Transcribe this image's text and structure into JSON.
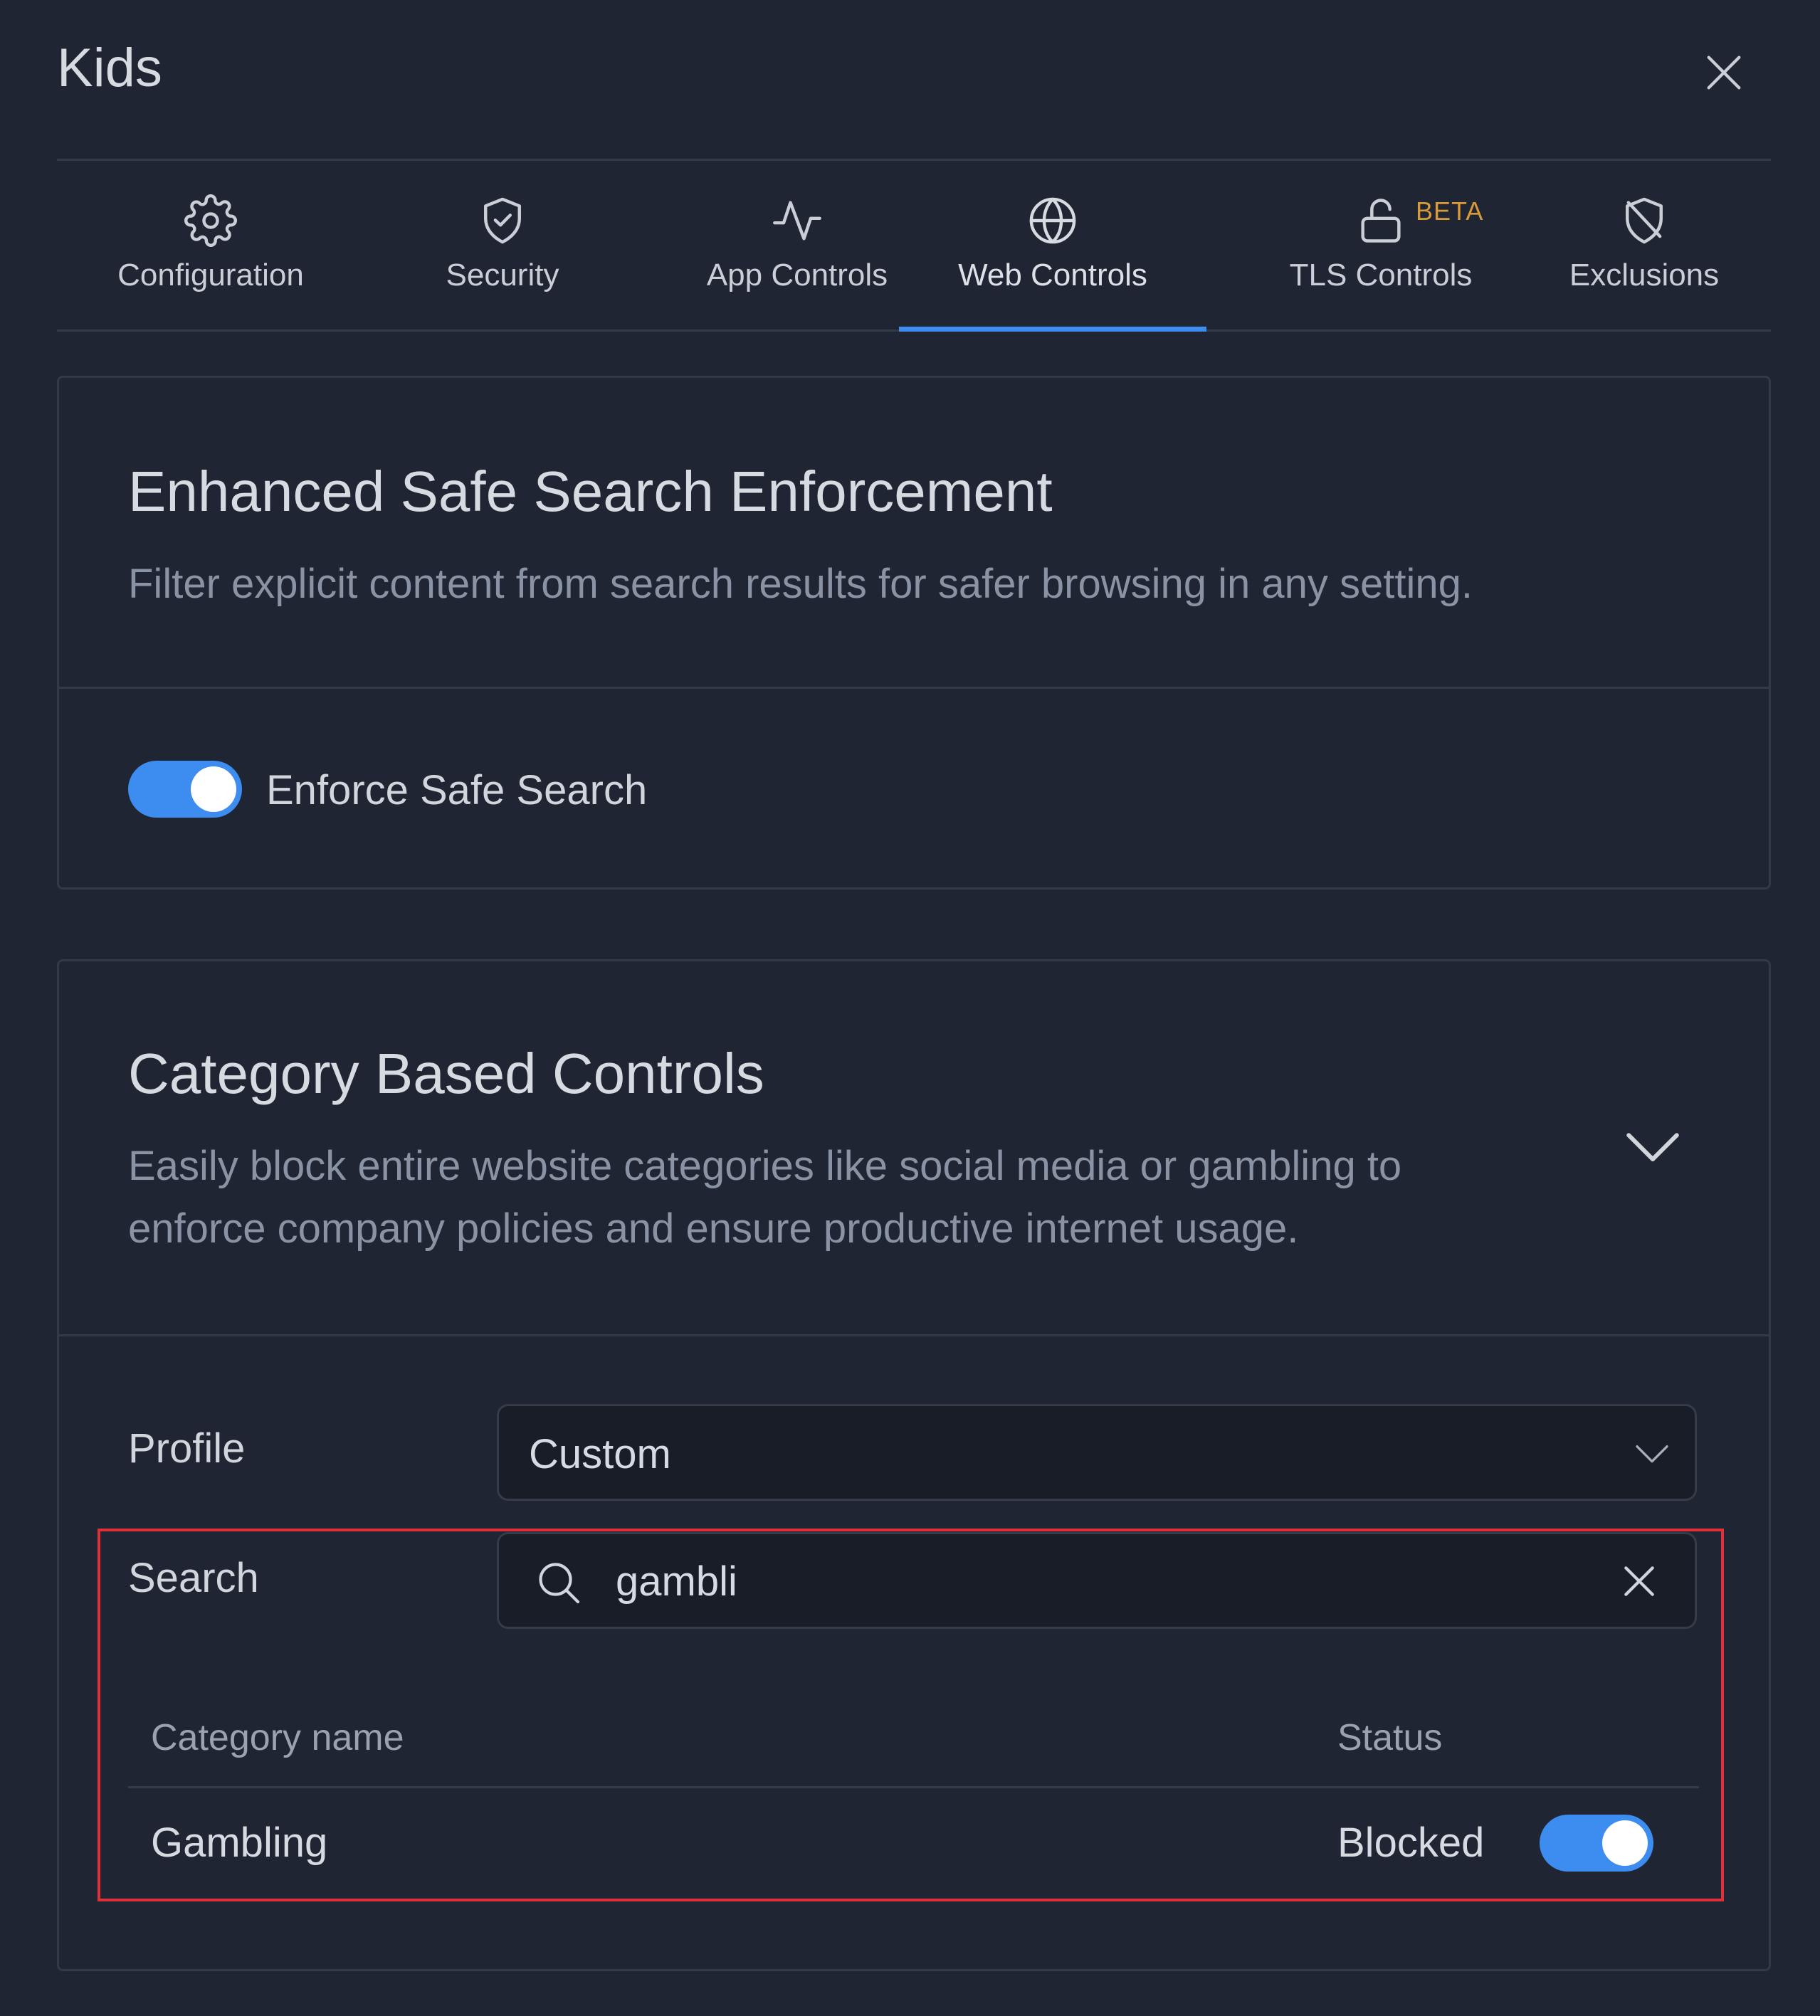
{
  "dialog": {
    "title": "Kids",
    "close_icon": "close-icon"
  },
  "tabs": [
    {
      "label": "Configuration",
      "icon": "gear-icon"
    },
    {
      "label": "Security",
      "icon": "shield-check-icon"
    },
    {
      "label": "App Controls",
      "icon": "activity-icon"
    },
    {
      "label": "Web Controls",
      "icon": "globe-icon",
      "active": true
    },
    {
      "label": "TLS Controls",
      "icon": "unlock-icon",
      "badge": "BETA"
    },
    {
      "label": "Exclusions",
      "icon": "shield-off-icon"
    }
  ],
  "safe_search": {
    "title": "Enhanced Safe Search Enforcement",
    "description": "Filter explicit content from search results for safer browsing in any setting.",
    "toggle_label": "Enforce Safe Search",
    "enabled": true
  },
  "category_controls": {
    "title": "Category Based Controls",
    "description_line1": "Easily block entire website categories like social media or gambling to",
    "description_line2": "enforce company policies and ensure productive internet usage.",
    "expand_icon": "chevron-down-icon",
    "profile_label": "Profile",
    "profile_value": "Custom",
    "search_label": "Search",
    "search_value": "gambli",
    "table": {
      "columns": [
        "Category name",
        "Status"
      ],
      "rows": [
        {
          "name": "Gambling",
          "status": "Blocked",
          "enabled": true
        }
      ]
    }
  },
  "colors": {
    "background": "#1f2533",
    "accent": "#3d8cf0",
    "beta": "#d89a3a",
    "highlight": "#e0303a"
  }
}
